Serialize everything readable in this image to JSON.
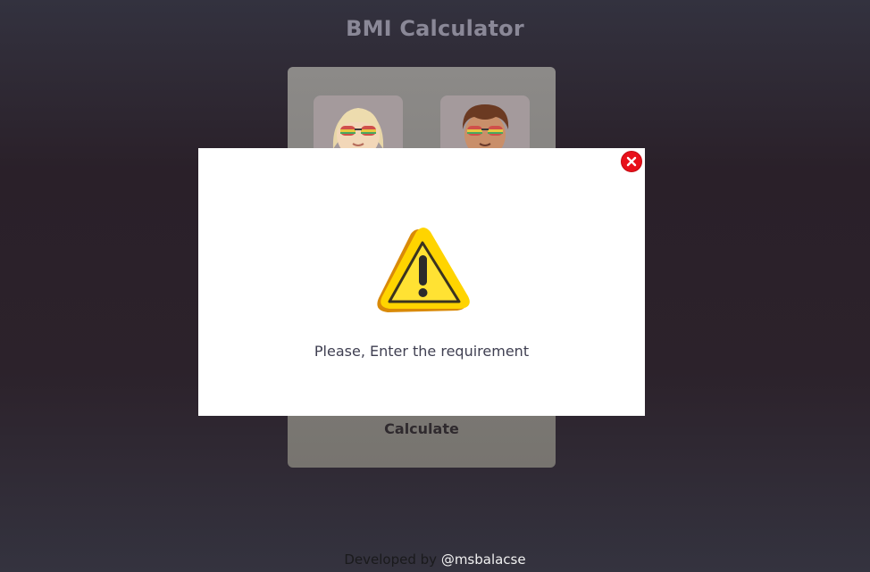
{
  "header": {
    "title": "BMI Calculator"
  },
  "card": {
    "gender_options": [
      {
        "id": "female",
        "icon": "female-avatar-icon"
      },
      {
        "id": "male",
        "icon": "male-avatar-icon"
      }
    ],
    "calculate_label": "Calculate"
  },
  "modal": {
    "icon": "warning-icon",
    "message": "Please, Enter the requirement",
    "close_icon": "close-icon"
  },
  "footer": {
    "prefix": "Developed by ",
    "handle": "@msbalacse"
  },
  "colors": {
    "background": "#2c222b",
    "card": "#8c8a88",
    "modal": "#ffffff",
    "close_button": "#e8101a",
    "warning_yellow": "#ffd400"
  }
}
